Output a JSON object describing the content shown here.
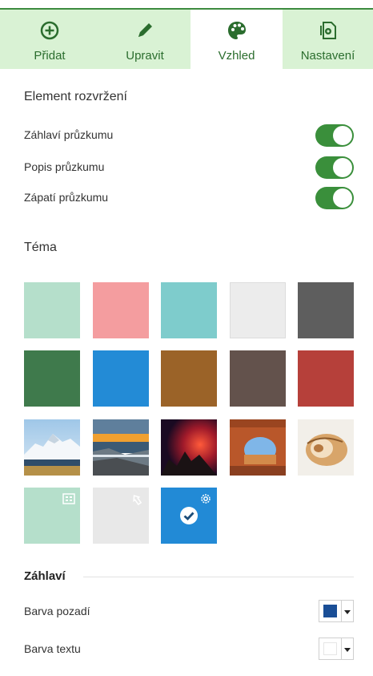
{
  "tabs": [
    {
      "label": "Přidat",
      "icon": "plus-circle-icon"
    },
    {
      "label": "Upravit",
      "icon": "pencil-icon"
    },
    {
      "label": "Vzhled",
      "icon": "palette-icon"
    },
    {
      "label": "Nastavení",
      "icon": "settings-document-icon"
    }
  ],
  "layout": {
    "title": "Element rozvržení",
    "items": [
      {
        "label": "Záhlaví průzkumu",
        "on": true
      },
      {
        "label": "Popis průzkumu",
        "on": true
      },
      {
        "label": "Zápatí průzkumu",
        "on": true
      }
    ]
  },
  "theme": {
    "title": "Téma",
    "colors": [
      "#b5dfcb",
      "#f49d9f",
      "#7ecccc",
      "#ececec",
      "#5e5e5e",
      "#3f7a4c",
      "#238bd6",
      "#9b6328",
      "#63524c",
      "#b6403a"
    ],
    "photos": [
      "mountain-snow",
      "coastal-sunset",
      "red-sky-mountain",
      "rock-arch",
      "seashell"
    ],
    "custom": [
      {
        "color": "#b5dfcb",
        "icon": "building-icon"
      },
      {
        "color": "#e8e8e8",
        "icon": "undo-icon"
      },
      {
        "color": "#228ad6",
        "icon": "gear-icon",
        "selected": true
      }
    ]
  },
  "header_section": {
    "title": "Záhlaví",
    "background_label": "Barva pozadí",
    "background_color": "#1a4e96",
    "text_label": "Barva textu",
    "text_color": "#ffffff"
  },
  "accent": "#3a8f3b"
}
